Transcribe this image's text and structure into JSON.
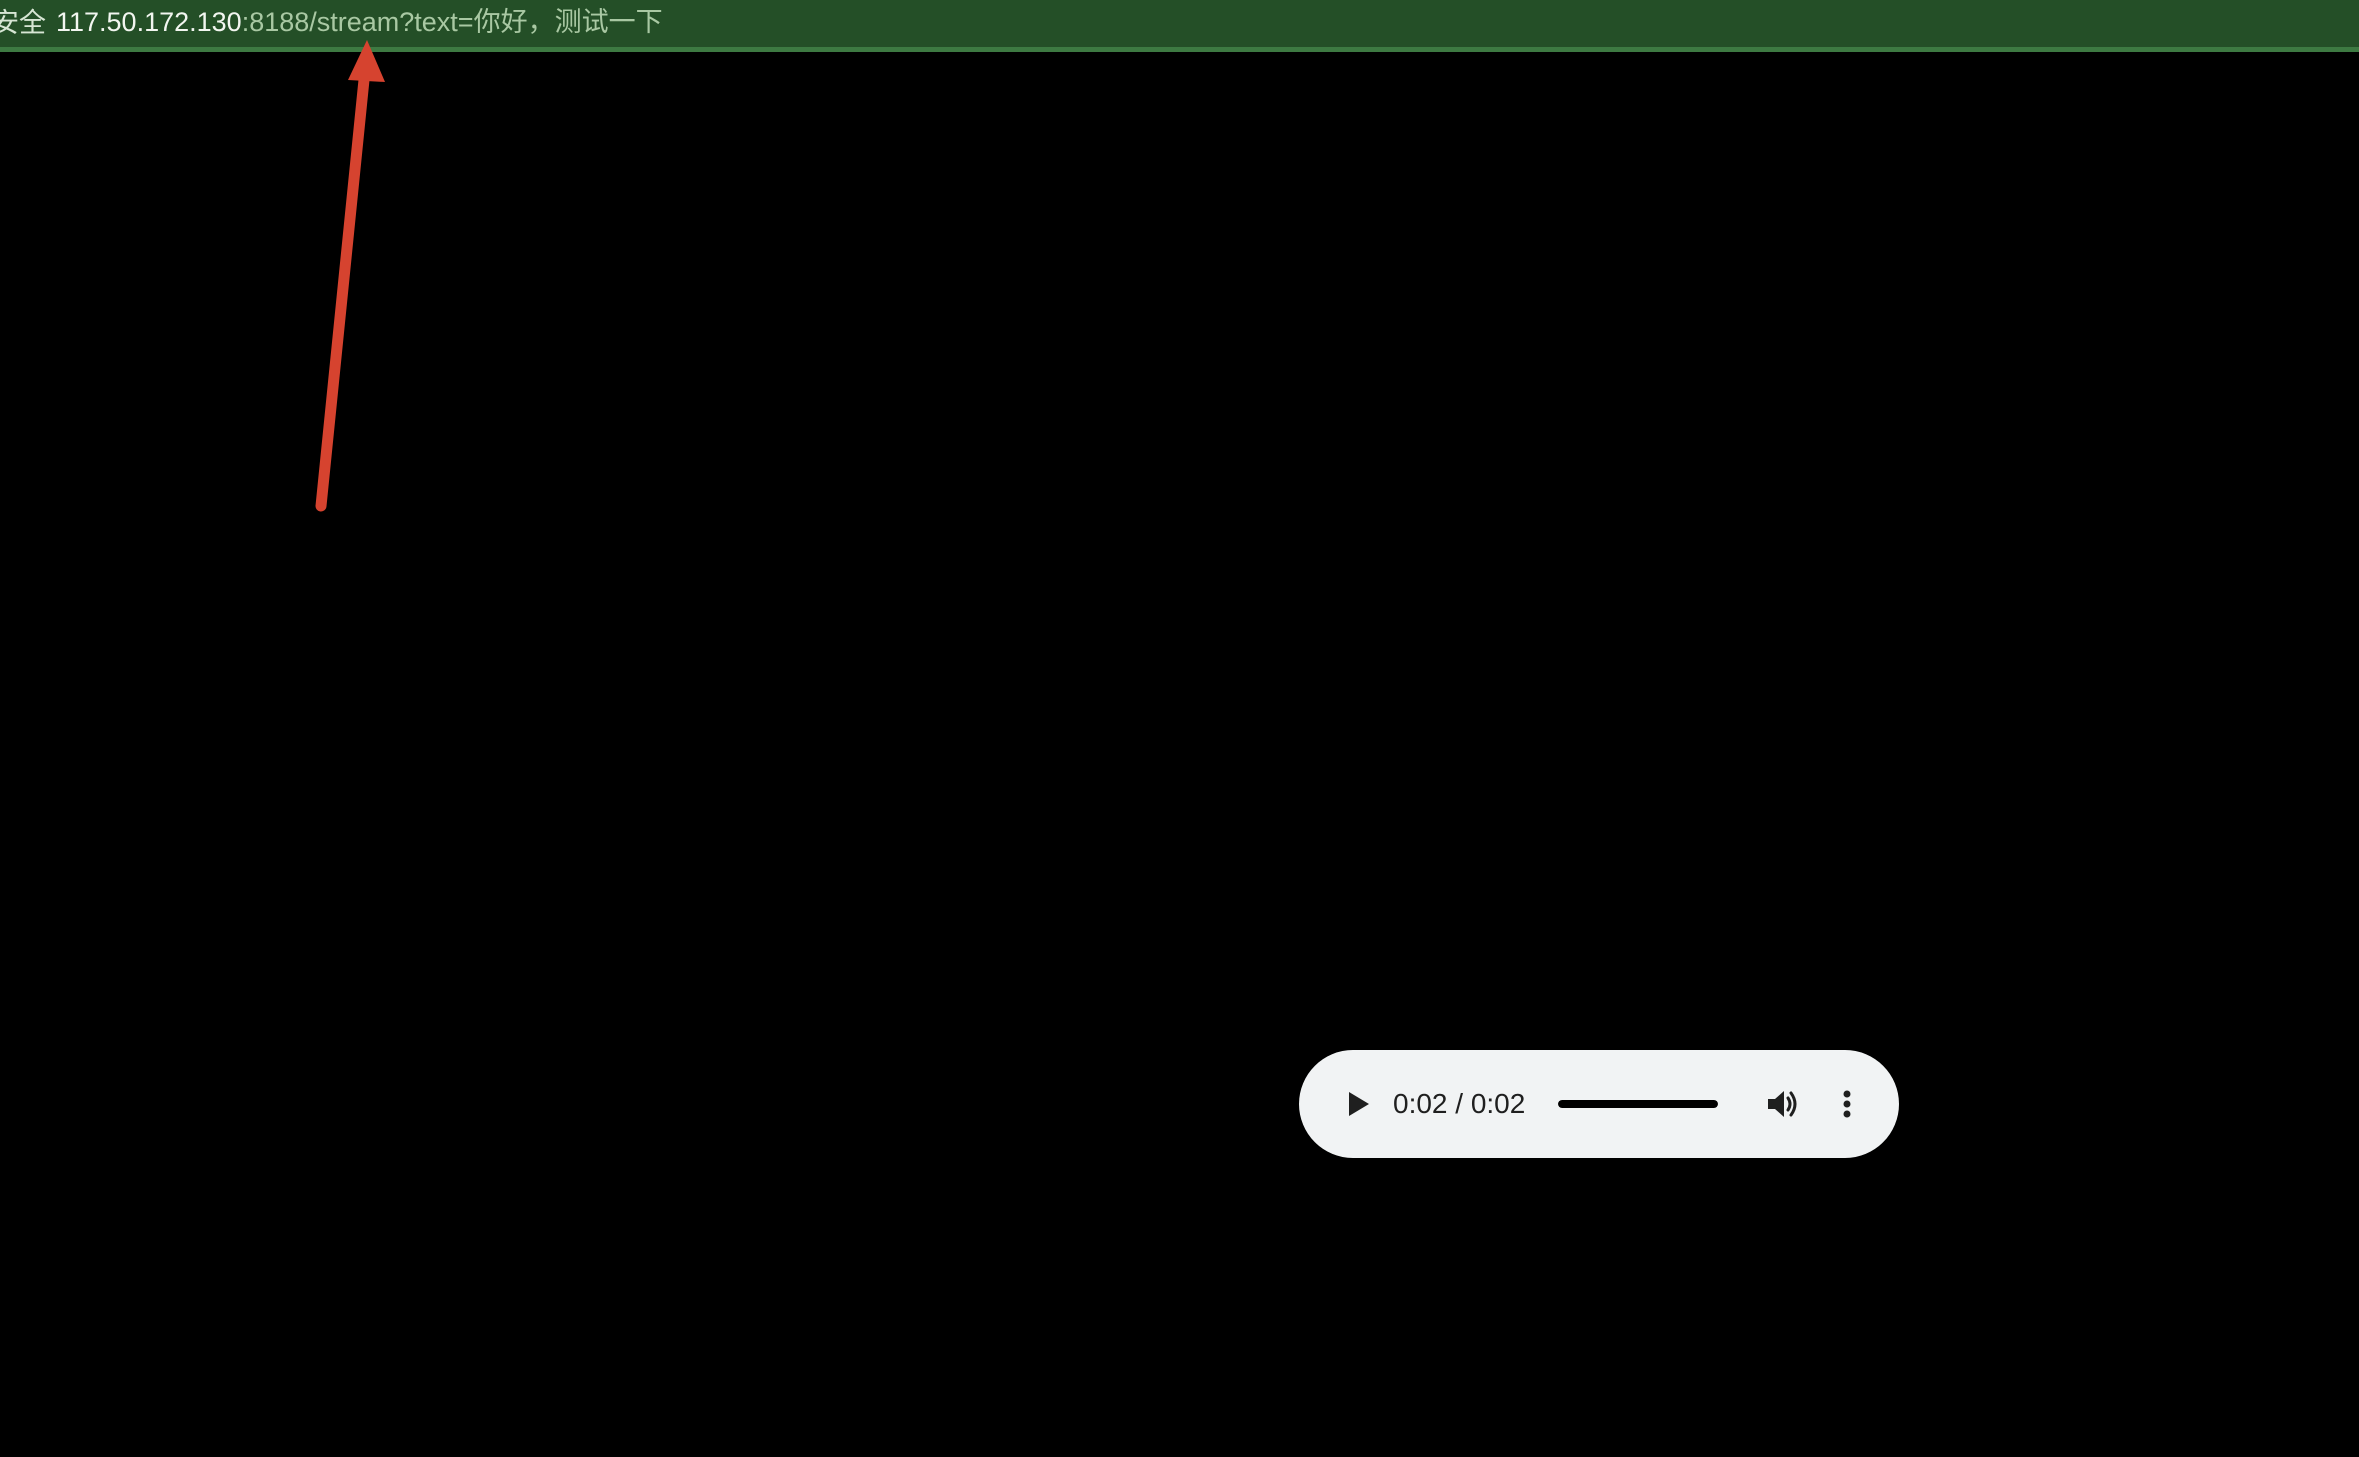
{
  "browser": {
    "security_label": "安全",
    "url_host": "117.50.172.130",
    "url_rest": ":8188/stream?text=你好，测试一下",
    "bar_color": "#244f27"
  },
  "annotation": {
    "arrow_color": "#d6432f",
    "icon": "red-arrow-pointing-up"
  },
  "audio_player": {
    "time_display": "0:02 / 0:02",
    "progress": 1.0,
    "play_icon": "play-icon",
    "volume_icon": "volume-icon",
    "more_icon": "more-vert-icon",
    "background": "#f1f3f4"
  }
}
